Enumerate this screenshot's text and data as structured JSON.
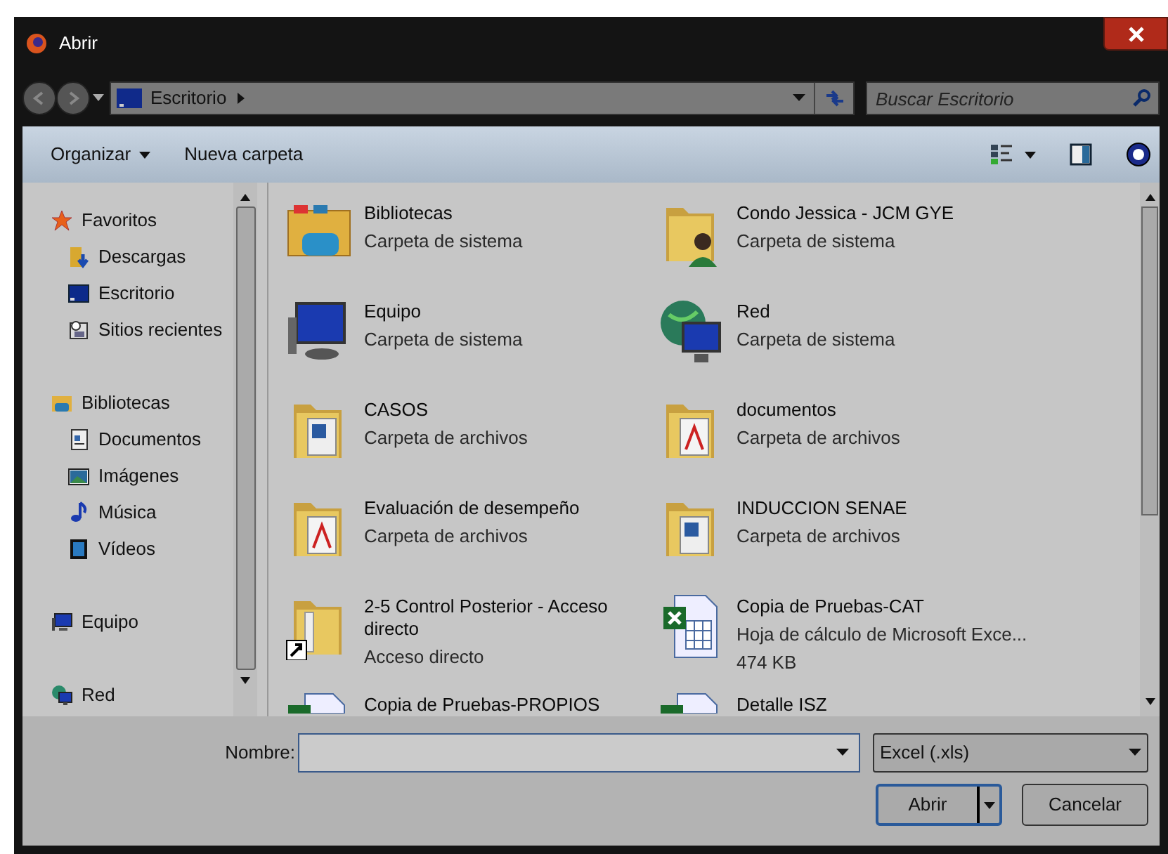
{
  "window": {
    "title": "Abrir"
  },
  "address": {
    "crumbs": [
      "Escritorio"
    ],
    "search_placeholder": "Buscar Escritorio"
  },
  "toolbar": {
    "organize": "Organizar",
    "new_folder": "Nueva carpeta"
  },
  "sidebar": [
    {
      "label": "Favoritos",
      "kind": "star",
      "children": [
        {
          "label": "Descargas",
          "kind": "download"
        },
        {
          "label": "Escritorio",
          "kind": "desktop"
        },
        {
          "label": "Sitios recientes",
          "kind": "recent"
        }
      ]
    },
    {
      "label": "Bibliotecas",
      "kind": "library",
      "children": [
        {
          "label": "Documentos",
          "kind": "document"
        },
        {
          "label": "Imágenes",
          "kind": "image"
        },
        {
          "label": "Música",
          "kind": "music"
        },
        {
          "label": "Vídeos",
          "kind": "video"
        }
      ]
    },
    {
      "label": "Equipo",
      "kind": "computer"
    },
    {
      "label": "Red",
      "kind": "network"
    }
  ],
  "items": [
    {
      "name": "Bibliotecas",
      "details": [
        "Carpeta de sistema"
      ],
      "kind": "library"
    },
    {
      "name": "Condo Jessica - JCM GYE",
      "details": [
        "Carpeta de sistema"
      ],
      "kind": "user"
    },
    {
      "name": "Equipo",
      "details": [
        "Carpeta de sistema"
      ],
      "kind": "computer"
    },
    {
      "name": "Red",
      "details": [
        "Carpeta de sistema"
      ],
      "kind": "network"
    },
    {
      "name": "CASOS",
      "details": [
        "Carpeta de archivos"
      ],
      "kind": "folder"
    },
    {
      "name": "documentos",
      "details": [
        "Carpeta de archivos"
      ],
      "kind": "pdf-folder"
    },
    {
      "name": "Evaluación de desempeño",
      "details": [
        "Carpeta de archivos"
      ],
      "kind": "pdf-folder"
    },
    {
      "name": "INDUCCION SENAE",
      "details": [
        "Carpeta de archivos"
      ],
      "kind": "folder"
    },
    {
      "name": "2-5 Control Posterior - Acceso directo",
      "details": [
        "Acceso directo"
      ],
      "kind": "shortcut"
    },
    {
      "name": "Copia de Pruebas-CAT",
      "details": [
        "Hoja de cálculo de Microsoft Exce...",
        "474 KB"
      ],
      "kind": "excel"
    },
    {
      "name": "Copia de Pruebas-PROPIOS",
      "kind": "excel-partial"
    },
    {
      "name": "Detalle ISZ",
      "kind": "excel-partial"
    }
  ],
  "footer": {
    "name_label": "Nombre:",
    "filter": "Excel (.xls)",
    "open": "Abrir",
    "cancel": "Cancelar"
  }
}
